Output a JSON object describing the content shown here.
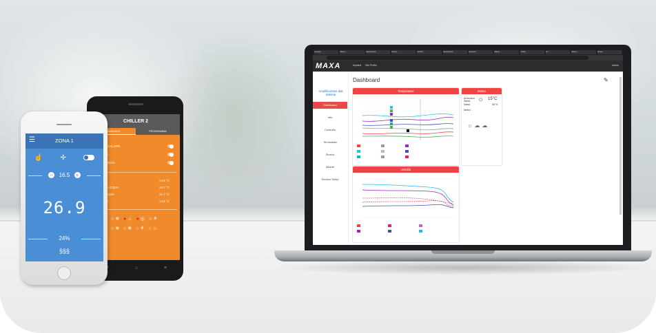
{
  "browser": {
    "tabs": [
      "Google",
      "Maxa - ",
      "Dashboard",
      "Meteo",
      "Grafici",
      "Dashboard",
      "Impianti",
      "Maxa",
      "Chiller",
      "Ac",
      "Maxa - ",
      "Meteo"
    ],
    "url": ""
  },
  "app": {
    "logo": "MAXA",
    "nav": [
      "Impianti",
      "Mio Profilo"
    ],
    "user": "Admin"
  },
  "sidebar": {
    "title": "Amplificazione dati sistema",
    "items": [
      "Dashboard",
      "Info",
      "Controllo",
      "Termostato",
      "Storico",
      "Allarmi",
      "Tecnico Setup"
    ]
  },
  "dashboard": {
    "title": "Dashboard",
    "temperature_card": {
      "title": "Temperature",
      "tooltips": [
        "",
        "",
        "",
        "",
        "",
        ""
      ],
      "hover_label": "",
      "legend": [
        {
          "name": "",
          "color": "#ef4444"
        },
        {
          "name": "",
          "color": "#9e9e9e"
        },
        {
          "name": "",
          "color": "#9c27b0"
        },
        {
          "name": "",
          "color": "#26c6da"
        },
        {
          "name": "",
          "color": "#b0bec5"
        },
        {
          "name": "",
          "color": "#3f51b5"
        },
        {
          "name": "",
          "color": "#ba68c8"
        },
        {
          "name": "",
          "color": "#4caf50"
        },
        {
          "name": "",
          "color": "#00bcd4"
        },
        {
          "name": "",
          "color": "#90a4ae"
        },
        {
          "name": "",
          "color": "#ff7043"
        },
        {
          "name": "",
          "color": "#e91e63"
        }
      ]
    },
    "umidita_card": {
      "title": "Umidità",
      "legend": [
        {
          "name": "",
          "color": "#ef4444"
        },
        {
          "name": "",
          "color": "#e91e63"
        },
        {
          "name": "",
          "color": "#ba68c8"
        },
        {
          "name": "",
          "color": "#9c27b0"
        },
        {
          "name": "",
          "color": "#3f51b5"
        },
        {
          "name": "",
          "color": "#29b6f6"
        }
      ]
    },
    "meteo_card": {
      "title": "Meteo",
      "location_lines": [
        "Arbizzano",
        "Santa",
        "Maria"
      ],
      "current_temp": "15°C",
      "humidity": "45 %",
      "provider": "Meteo",
      "forecast_days": [
        "",
        "",
        ""
      ],
      "forecast_temps": [
        "",
        "",
        ""
      ]
    }
  },
  "chiller_phone": {
    "title": "CHILLER 2",
    "tabs": [
      "MANUALE",
      "PROGRAMMA"
    ],
    "rows": [
      "OMPA DI CALORE",
      "ANITARIO",
      "OMFORT/ECO"
    ],
    "readouts": [
      {
        "label": "STERNA",
        "value": "14.5 °C"
      },
      {
        "label": "GRESSO ACQUA",
        "value": "23.7 °C"
      },
      {
        "label": "SCITA ACQUA",
        "value": "21.7 °C"
      },
      {
        "label": "ANITARIO",
        "value": "14.5 °C"
      }
    ]
  },
  "zona_phone": {
    "title": "ZONA 1",
    "setpoint": "16.5",
    "temperature": "26.9",
    "humidity": "24%",
    "heat_symbol": "§§§"
  }
}
